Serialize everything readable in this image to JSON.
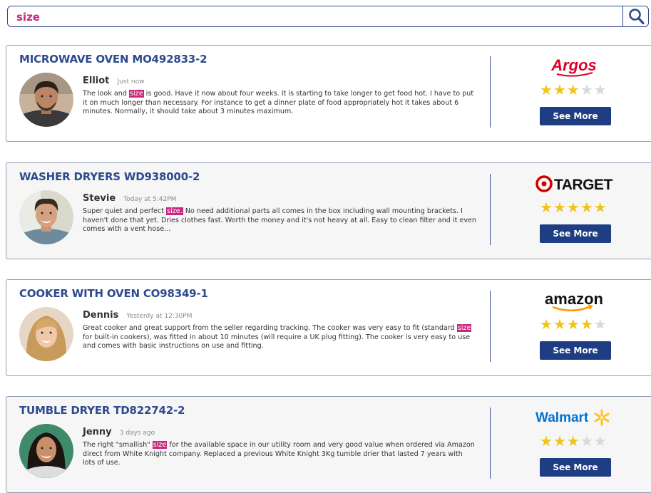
{
  "search": {
    "value": "size"
  },
  "highlight_color": "#c6287f",
  "brand_colors": {
    "argos": "#e0002a",
    "target": "#cc0000",
    "amazon": "#111111",
    "walmart": "#0071ce",
    "walmart_spark": "#ffc220"
  },
  "reviews": [
    {
      "product": "MICROWAVE OVEN MO492833-2",
      "reviewer": "Elliot",
      "time": "Just now",
      "text_before": "The look and ",
      "highlight": "size",
      "text_after": " is good. Have it now about four weeks. It is starting to take longer to get food hot. I have to put it on much longer than necessary. For instance to get a dinner plate of food appropriately hot it takes about 6 minutes. Normally, it should take about 3 minutes maximum.",
      "retailer": "Argos",
      "rating": 3,
      "rating_max": 5,
      "button": "See More"
    },
    {
      "product": "WASHER DRYERS WD938000-2",
      "reviewer": "Stevie",
      "time": "Today at 5:42PM",
      "text_before": "Super quiet and perfect ",
      "highlight": "size.",
      "text_after": " No need additional parts all comes in the box including wall mounting brackets. I haven't done that yet. Dries clothes fast. Worth the money and it's not heavy at all. Easy to clean filter and it even comes with a vent hose...",
      "retailer": "TARGET",
      "rating": 5,
      "rating_max": 5,
      "button": "See More"
    },
    {
      "product": "COOKER WITH OVEN CO98349-1",
      "reviewer": "Dennis",
      "time": "Yesterdy at 12:30PM",
      "text_before": "Great cooker and great support from the seller regarding tracking. The cooker was very easy to fit (standard ",
      "highlight": "size",
      "text_after": " for built-in cookers), was fitted in about 10 minutes (will require a UK plug fitting). The cooker is very easy to use and comes with basic instructions on use and fitting.",
      "retailer": "amazon",
      "rating": 4,
      "rating_max": 5,
      "button": "See More"
    },
    {
      "product": "TUMBLE DRYER TD822742-2",
      "reviewer": "Jenny",
      "time": "3 days ago",
      "text_before": "The right \"smallish\" ",
      "highlight": "size",
      "text_after": " for the available space in our utility room and very good value when ordered via Amazon direct from White Knight company. Replaced a previous White Knight 3Kg tumble drier that lasted 7 years with lots of use.",
      "retailer": "Walmart",
      "rating": 3,
      "rating_max": 5,
      "button": "See More"
    }
  ]
}
